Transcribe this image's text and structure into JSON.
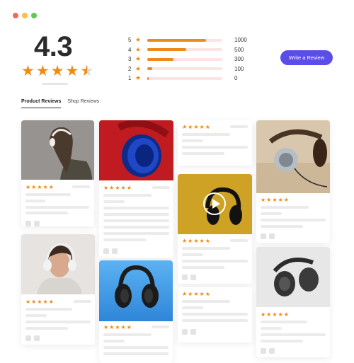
{
  "window_dots": {
    "colors": [
      "#ee6a5f",
      "#f5be4f",
      "#62c554"
    ]
  },
  "summary": {
    "score": "4.3",
    "rating": 4.3,
    "max_stars": 5
  },
  "breakdown": [
    {
      "stars": "5",
      "count": "1000",
      "fill": 0.78
    },
    {
      "stars": "4",
      "count": "500",
      "fill": 0.52
    },
    {
      "stars": "3",
      "count": "300",
      "fill": 0.35
    },
    {
      "stars": "2",
      "count": "100",
      "fill": 0.07
    },
    {
      "stars": "1",
      "count": "0",
      "fill": 0.02
    }
  ],
  "write_review": {
    "label": "Write a Review"
  },
  "tabs": [
    {
      "label": "Product Reviews",
      "active": true
    },
    {
      "label": "Shop Reviews",
      "active": false
    }
  ],
  "review_card": {
    "stars": "★★★★★"
  },
  "colors": {
    "accent": "#5b4ee8",
    "star": "#f08a12",
    "bar_fill": "#ec8a1c",
    "bar_track": "#fde3e3"
  }
}
